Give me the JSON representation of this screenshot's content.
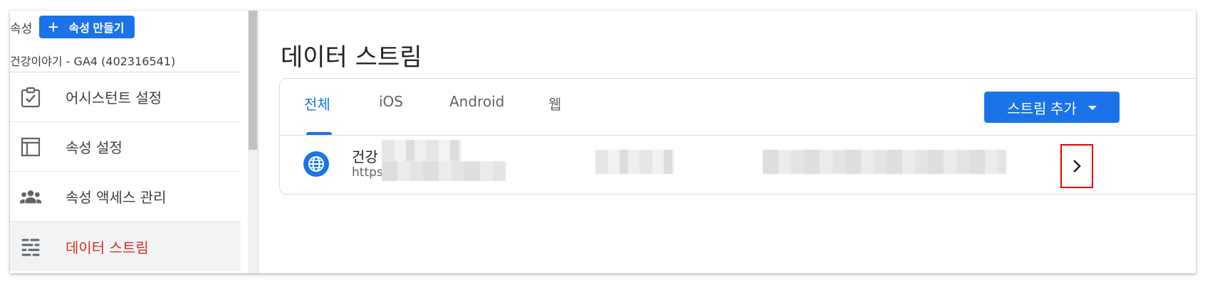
{
  "sidebar": {
    "property_label": "속성",
    "create_button": "속성 만들기",
    "account_name": "건강이야기 - GA4 (402316541)",
    "items": [
      {
        "label": "어시스턴트 설정",
        "icon": "clipboard-check-icon"
      },
      {
        "label": "속성 설정",
        "icon": "layout-icon"
      },
      {
        "label": "속성 액세스 관리",
        "icon": "people-icon"
      },
      {
        "label": "데이터 스트림",
        "icon": "data-stream-icon",
        "active": true
      }
    ]
  },
  "main": {
    "title": "데이터 스트림",
    "tabs": [
      "전체",
      "iOS",
      "Android",
      "웹"
    ],
    "active_tab": "전체",
    "add_stream_button": "스트림 추가",
    "streams": [
      {
        "name_visible": "건강",
        "url_visible": "https:",
        "icon": "globe-icon"
      }
    ]
  },
  "colors": {
    "accent": "#1a73e8",
    "active_nav_text": "#d93025",
    "highlight_box": "#e60000"
  }
}
